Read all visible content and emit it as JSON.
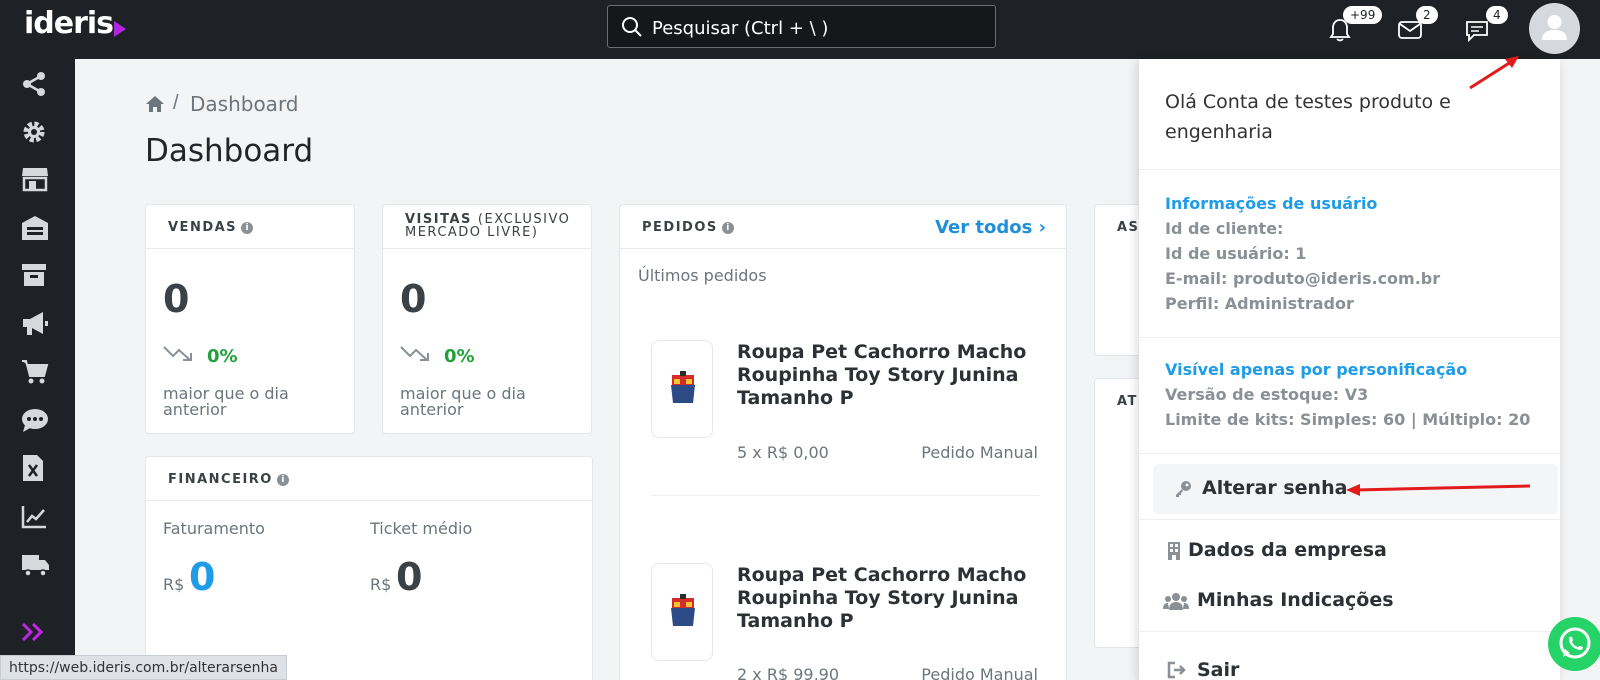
{
  "header": {
    "logo": "ideris",
    "search_placeholder": "Pesquisar (Ctrl + \\ )",
    "notifications_badge": "+99",
    "messages_badge": "2",
    "chat_badge": "4"
  },
  "sidebar": {
    "items": [
      "share-icon",
      "gear-icon",
      "store-icon",
      "warehouse-icon",
      "archive-icon",
      "megaphone-icon",
      "cart-icon",
      "chat-icon",
      "excel-icon",
      "chart-icon",
      "truck-icon"
    ],
    "expand": "expand-icon"
  },
  "breadcrumb": {
    "current": "Dashboard",
    "sep": "/"
  },
  "page_title": "Dashboard",
  "cards": {
    "vendas": {
      "label": "VENDAS",
      "value": "0",
      "pct": "0%",
      "note": "maior que o dia anterior"
    },
    "visitas": {
      "label": "VISITAS",
      "label_sub": "(EXCLUSIVO",
      "label_sub2": "MERCADO LIVRE)",
      "value": "0",
      "pct": "0%",
      "note": "maior que o dia anterior"
    },
    "pedidos": {
      "label": "PEDIDOS",
      "link": "Ver todos",
      "subtitle": "Últimos pedidos",
      "orders": [
        {
          "title": "Roupa Pet Cachorro Macho Roupinha Toy Story Junina Tamanho P",
          "qty": "5 x R$ 0,00",
          "type": "Pedido Manual"
        },
        {
          "title": "Roupa Pet Cachorro Macho Roupinha Toy Story Junina Tamanho P",
          "qty": "2 x R$ 99,90",
          "type": "Pedido Manual"
        }
      ]
    },
    "financeiro": {
      "label": "FINANCEIRO",
      "faturamento_label": "Faturamento",
      "ticket_label": "Ticket médio",
      "currency": "R$",
      "faturamento": "0",
      "ticket": "0"
    },
    "as_label": "AS",
    "at_label": "AT"
  },
  "dropdown": {
    "greeting": "Olá Conta de testes produto e engenharia",
    "user_info_title": "Informações de usuário",
    "client_id": "Id de cliente:",
    "user_id": "Id de usuário: 1",
    "email": "E-mail: produto@ideris.com.br",
    "profile": "Perfil: Administrador",
    "personification_title": "Visível apenas por personificação",
    "stock_version": "Versão de estoque: V3",
    "kit_limit": "Limite de kits: Simples: 60 | Múltiplo: 20",
    "change_password": "Alterar senha",
    "company_data": "Dados da empresa",
    "referrals": "Minhas Indicações",
    "logout": "Sair"
  },
  "status_bar_url": "https://web.ideris.com.br/alterarsenha",
  "colors": {
    "topbar": "#1e2126",
    "accent": "#1e9ce8",
    "positive": "#22a03a",
    "arrow": "#e11b1b",
    "logo_accent": "#b124e0"
  }
}
